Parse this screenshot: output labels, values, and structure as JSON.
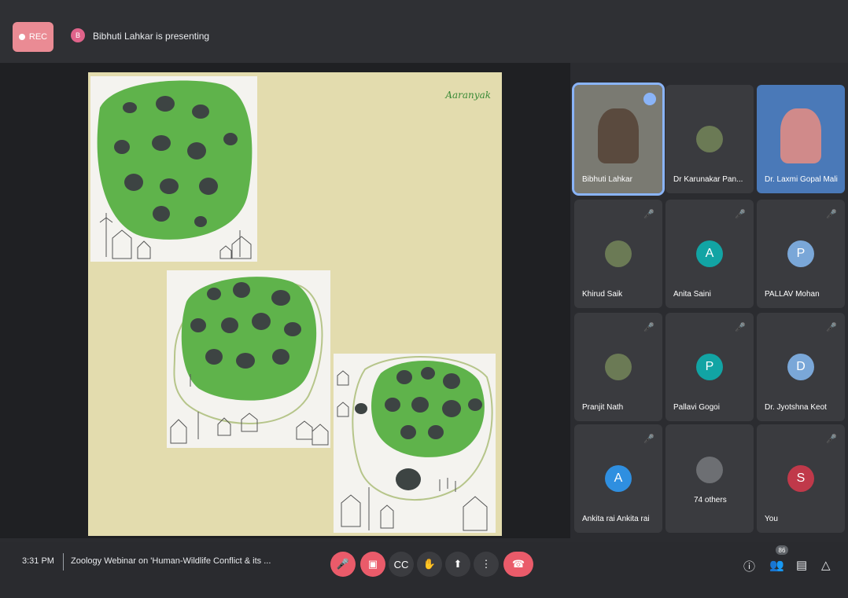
{
  "header": {
    "rec_label": "REC",
    "presenter_initial": "B",
    "presenting_text": "Bibhuti Lahkar is presenting"
  },
  "slide": {
    "logo_text": "Aaranyak"
  },
  "participants": [
    {
      "name": "Bibhuti Lahkar",
      "kind": "video",
      "speaking": true
    },
    {
      "name": "Dr Karunakar Pan...",
      "kind": "photo"
    },
    {
      "name": "Dr. Laxmi Gopal Mali",
      "kind": "video"
    },
    {
      "name": "Khirud Saik",
      "kind": "photo",
      "muted": true
    },
    {
      "name": "Anita Saini",
      "kind": "initial",
      "initial": "A",
      "color": "#12a4a4",
      "muted": true
    },
    {
      "name": "PALLAV Mohan",
      "kind": "initial",
      "initial": "P",
      "color": "#7aa7d8",
      "muted": true
    },
    {
      "name": "Pranjit Nath",
      "kind": "photo",
      "muted": true
    },
    {
      "name": "Pallavi Gogoi",
      "kind": "initial",
      "initial": "P",
      "color": "#12a4a4",
      "muted": true
    },
    {
      "name": "Dr. Jyotshna Keot",
      "kind": "initial",
      "initial": "D",
      "color": "#7aa7d8",
      "muted": true
    },
    {
      "name": "Ankita rai Ankita rai",
      "kind": "initial",
      "initial": "A",
      "color": "#2f8fe0",
      "muted": true
    },
    {
      "name": "74 others",
      "kind": "others"
    },
    {
      "name": "You",
      "kind": "initial",
      "initial": "S",
      "color": "#c0394a",
      "muted": true
    }
  ],
  "footer": {
    "time": "3:31 PM",
    "meeting_title": "Zoology Webinar on 'Human-Wildlife Conflict & its ...",
    "people_count": "86",
    "colors": {
      "red": "#ea5b6a",
      "end": "#ea5b6a"
    }
  }
}
